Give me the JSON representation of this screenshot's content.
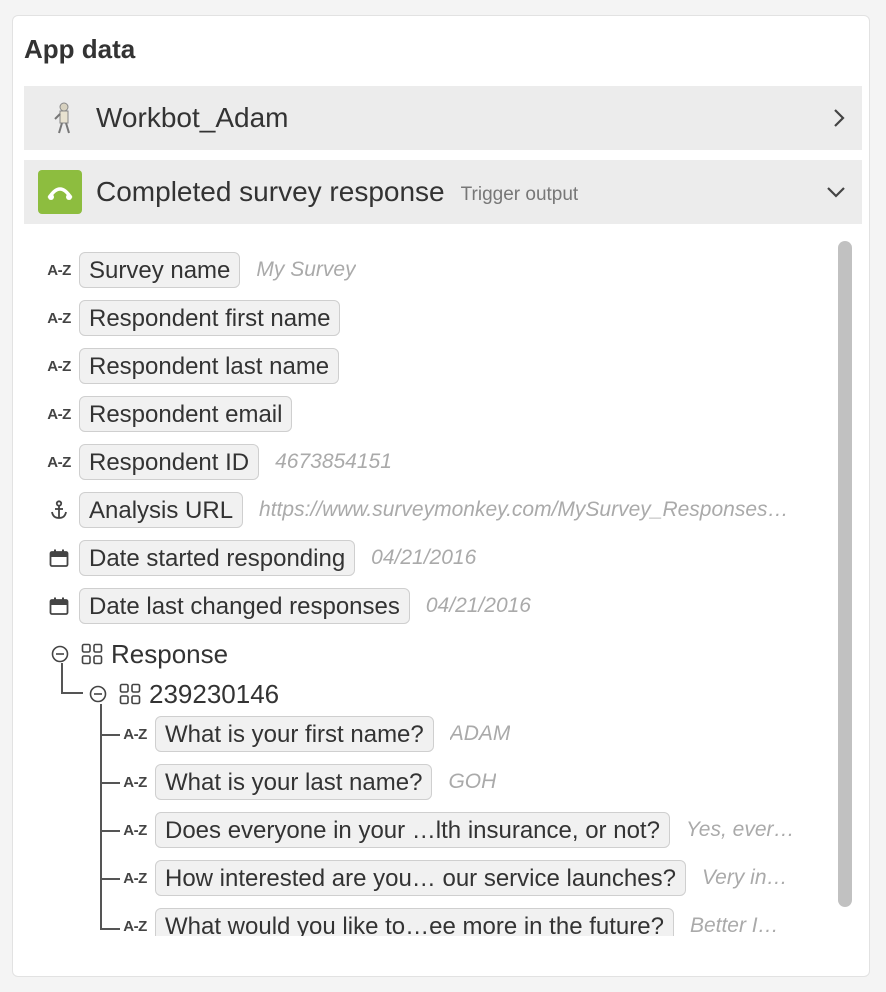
{
  "panel": {
    "title": "App data"
  },
  "workbot": {
    "name": "Workbot_Adam"
  },
  "trigger": {
    "name": "Completed survey response",
    "subtitle": "Trigger output"
  },
  "fields": [
    {
      "type": "A-Z",
      "icon": "text-type-icon",
      "label": "Survey name",
      "sample": "My Survey"
    },
    {
      "type": "A-Z",
      "icon": "text-type-icon",
      "label": "Respondent first name",
      "sample": ""
    },
    {
      "type": "A-Z",
      "icon": "text-type-icon",
      "label": "Respondent last name",
      "sample": ""
    },
    {
      "type": "A-Z",
      "icon": "text-type-icon",
      "label": "Respondent email",
      "sample": ""
    },
    {
      "type": "A-Z",
      "icon": "text-type-icon",
      "label": "Respondent ID",
      "sample": "4673854151"
    },
    {
      "type": "anchor",
      "icon": "anchor-icon",
      "label": "Analysis URL",
      "sample": "https://www.surveymonkey.com/MySurvey_Responses…"
    },
    {
      "type": "date",
      "icon": "calendar-icon",
      "label": "Date started responding",
      "sample": "04/21/2016"
    },
    {
      "type": "date",
      "icon": "calendar-icon",
      "label": "Date last changed responses",
      "sample": "04/21/2016"
    }
  ],
  "response": {
    "label": "Response",
    "child": {
      "label": "239230146",
      "questions": [
        {
          "type": "A-Z",
          "label": "What is your first name?",
          "sample": "ADAM"
        },
        {
          "type": "A-Z",
          "label": "What is your last name?",
          "sample": "GOH"
        },
        {
          "type": "A-Z",
          "label": "Does everyone in your …lth insurance, or not?",
          "sample": "Yes, ever…"
        },
        {
          "type": "A-Z",
          "label": "How interested are you… our service launches?",
          "sample": "Very in…"
        },
        {
          "type": "A-Z",
          "label": "What would you like to…ee more in the future?",
          "sample": "Better I…"
        }
      ]
    }
  },
  "colors": {
    "accent_logo": "#8dbd3f",
    "row_bg": "#ececec",
    "pill_bg": "#f1f1f1"
  }
}
